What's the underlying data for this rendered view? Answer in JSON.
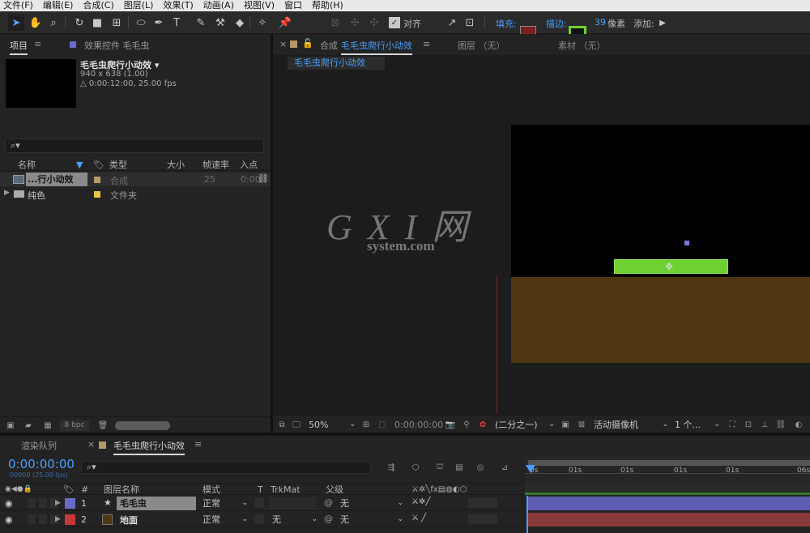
{
  "menu": [
    "文件(F)",
    "编辑(E)",
    "合成(C)",
    "图层(L)",
    "效果(T)",
    "动画(A)",
    "视图(V)",
    "窗口",
    "帮助(H)"
  ],
  "toolbar": {
    "align_label": "对齐",
    "fill_label": "填充:",
    "stroke_label": "描边:",
    "stroke_width": "39",
    "stroke_unit": "像素",
    "add_label": "添加:",
    "fill_color": "#7a2020",
    "stroke_color": "#6fd032"
  },
  "project_panel": {
    "tab_project": "项目",
    "tab_effects": "效果控件 毛毛虫",
    "comp_name": "毛毛虫爬行小动效 ▾",
    "comp_size": "940 x 638 (1.00)",
    "comp_duration": "△ 0:00:12:00, 25.00 fps",
    "search_placeholder": "",
    "columns": {
      "name": "名称",
      "type": "类型",
      "size": "大小",
      "fps": "帧速率",
      "in": "入点"
    },
    "rows": [
      {
        "name": "...行小动效",
        "type": "合成",
        "size": "",
        "fps": "25",
        "in": "0:00",
        "label_color": "#b59a6a"
      },
      {
        "name": "纯色",
        "type": "文件夹",
        "size": "",
        "fps": "",
        "in": "",
        "label_color": "#e8c840"
      }
    ],
    "bpc": "8 bpc"
  },
  "comp_panel": {
    "tab_prefix": "合成",
    "tab_name": "毛毛虫爬行小动效",
    "layer_tab": "图层 （无）",
    "footage_tab": "素材 （无）",
    "breadcrumb": "毛毛虫爬行小动效",
    "zoom": "50%",
    "timecode": "0:00:00:00",
    "resolution": "(二分之一)",
    "camera": "活动摄像机",
    "views": "1 个..."
  },
  "watermark": {
    "logo": "G X I 网",
    "site": "system.com"
  },
  "timeline": {
    "tab_render": "渲染队列",
    "tab_comp": "毛毛虫爬行小动效",
    "timecode": "0:00:00:00",
    "fps_info": "00000 (25.00 fps)",
    "col_hash": "#",
    "col_name": "图层名称",
    "col_mode": "模式",
    "col_t": "T",
    "col_trkmat": "TrkMat",
    "col_parent": "父级",
    "ruler": [
      "0s",
      "01s",
      "01s",
      "01s",
      "01s",
      "06s"
    ],
    "layers": [
      {
        "num": "1",
        "name": "毛毛虫",
        "mode": "正常",
        "trkmat": "",
        "parent": "无",
        "color": "#6a6ac8",
        "bar_color": "#5c5cb0"
      },
      {
        "num": "2",
        "name": "地面",
        "mode": "正常",
        "trkmat": "无",
        "parent": "无",
        "color": "#c83838",
        "bar_color": "#8a3a3a"
      }
    ]
  },
  "colors": {
    "ground": "#4e3610",
    "caterpillar": "#6fd032",
    "small_square": "#7878d8",
    "accent": "#4a9fff"
  }
}
